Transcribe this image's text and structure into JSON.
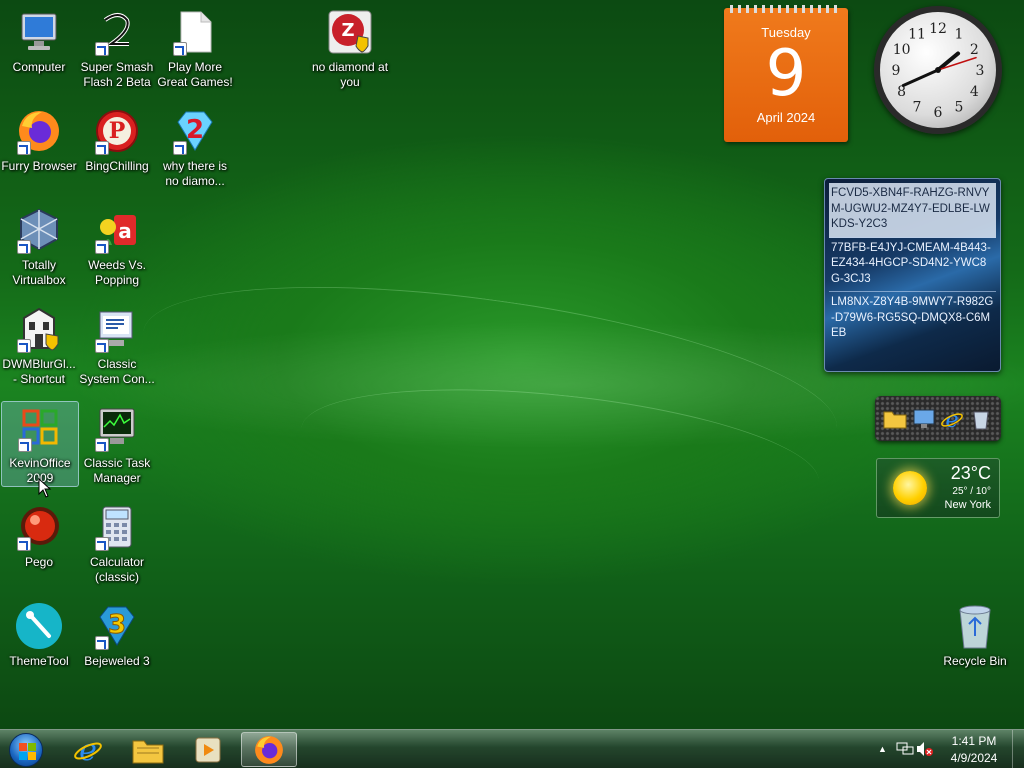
{
  "desktop_icons": [
    {
      "label": "Computer",
      "icon": "computer-icon",
      "shortcut": false
    },
    {
      "label": "Super Smash Flash 2 Beta",
      "icon": "ssf2-icon",
      "shortcut": true
    },
    {
      "label": "Play More Great Games!",
      "icon": "file-icon",
      "shortcut": true
    },
    {
      "label": "no diamond at you",
      "icon": "zip-shield-icon",
      "shortcut": false
    },
    {
      "label": "Furry Browser",
      "icon": "firefox-icon",
      "shortcut": true
    },
    {
      "label": "BingChilling",
      "icon": "p-logo-icon",
      "shortcut": true
    },
    {
      "label": "why there is no diamo...",
      "icon": "diamond-2-icon",
      "shortcut": true
    },
    {
      "label": "Totally Virtualbox",
      "icon": "virtualbox-icon",
      "shortcut": true
    },
    {
      "label": "Weeds Vs. Popping",
      "icon": "weeds-icon",
      "shortcut": true
    },
    {
      "label": "DWMBlurGl... - Shortcut",
      "icon": "building-shield-icon",
      "shortcut": true
    },
    {
      "label": "Classic System Con...",
      "icon": "system-config-icon",
      "shortcut": true
    },
    {
      "label": "KevinOffice 2009",
      "icon": "office-icon",
      "shortcut": true,
      "selected": true
    },
    {
      "label": "Classic Task Manager",
      "icon": "task-manager-icon",
      "shortcut": true
    },
    {
      "label": "Pego",
      "icon": "red-ball-icon",
      "shortcut": true
    },
    {
      "label": "Calculator (classic)",
      "icon": "calculator-icon",
      "shortcut": true
    },
    {
      "label": "ThemeTool",
      "icon": "themetool-icon",
      "shortcut": false
    },
    {
      "label": "Bejeweled 3",
      "icon": "bejeweled-icon",
      "shortcut": true
    },
    {
      "label": "Recycle Bin",
      "icon": "recycle-bin-icon",
      "shortcut": false
    }
  ],
  "calendar": {
    "day_of_week": "Tuesday",
    "day": "9",
    "month_year": "April 2024"
  },
  "clock": {
    "hour": 1,
    "minute": 41,
    "second": 12
  },
  "product_keys": [
    "FCVD5-XBN4F-RAHZG-RNVYM-UGWU2-MZ4Y7-EDLBE-LWKDS-Y2C3",
    "77BFB-E4JYJ-CMEAM-4B443-EZ434-4HGCP-SD4N2-YWC8G-3CJ3",
    "LM8NX-Z8Y4B-9MWY7-R982G-D79W6-RG5SQ-DMQX8-C6MEB"
  ],
  "weather": {
    "temp": "23°C",
    "range": "25° / 10°",
    "city": "New York"
  },
  "taskbar": {
    "pinned": [
      "internet-explorer-icon",
      "file-explorer-icon",
      "media-player-icon",
      "firefox-icon"
    ],
    "time": "1:41 PM",
    "date": "4/9/2024"
  }
}
